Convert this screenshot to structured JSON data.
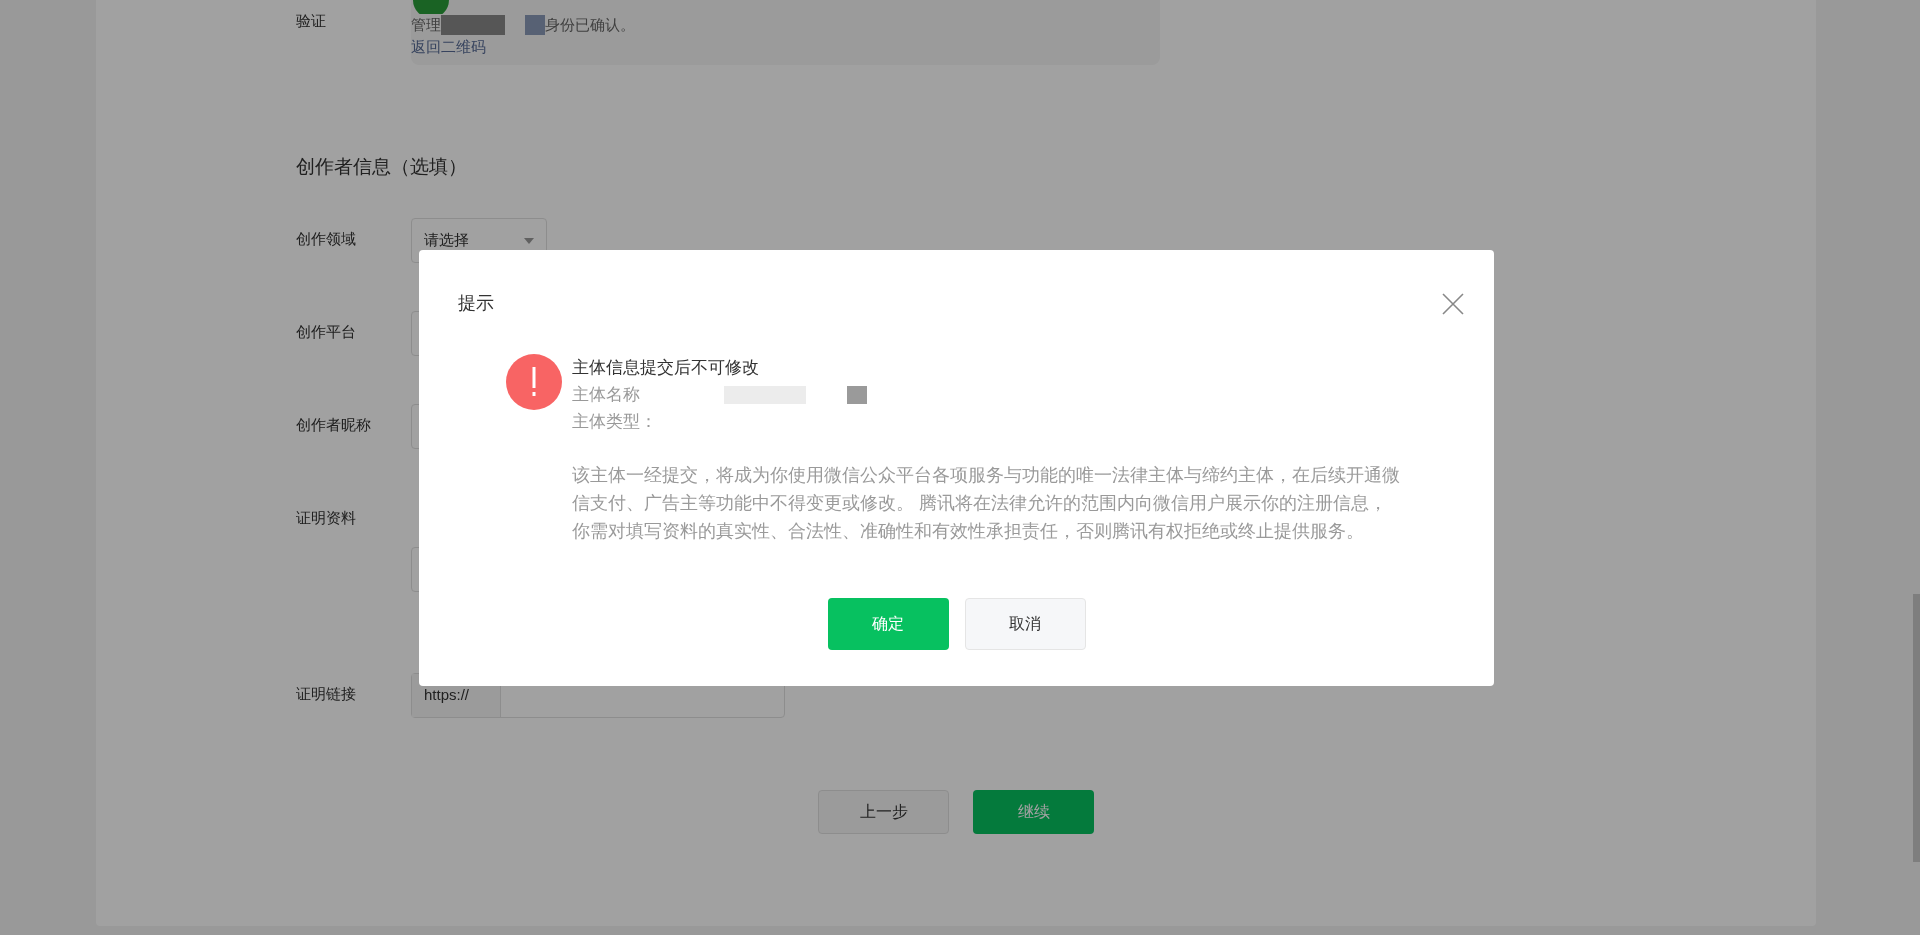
{
  "verify": {
    "label": "验证",
    "status_prefix": "管理",
    "status_suffix": "身份已确认。",
    "back_link": "返回二维码"
  },
  "creator_section": {
    "title": "创作者信息（选填）"
  },
  "fields": [
    {
      "kind": "select",
      "label": "创作领域",
      "value": "请选择"
    },
    {
      "kind": "input",
      "label": "创作平台"
    },
    {
      "kind": "input",
      "label": "创作者昵称"
    },
    {
      "kind": "upload",
      "label": "证明资料"
    },
    {
      "kind": "url",
      "label": "证明链接",
      "prefix": "https://"
    }
  ],
  "footer_buttons": [
    {
      "label": "上一步",
      "primary": false
    },
    {
      "label": "继续",
      "primary": true
    }
  ],
  "dialog": {
    "title": "提示",
    "heading": "主体信息提交后不可修改",
    "name_label": "主体名称",
    "type_label": "主体类型：",
    "notice": "该主体一经提交，将成为你使用微信公众平台各项服务与功能的唯一法律主体与缔约主体，在后续开通微信支付、广告主等功能中不得变更或修改。 腾讯将在法律允许的范围内向微信用户展示你的注册信息，你需对填写资料的真实性、合法性、准确性和有效性承担责任，否则腾讯有权拒绝或终止提供服务。",
    "buttons": [
      {
        "label": "确定",
        "primary": true
      },
      {
        "label": "取消",
        "primary": false
      }
    ]
  }
}
